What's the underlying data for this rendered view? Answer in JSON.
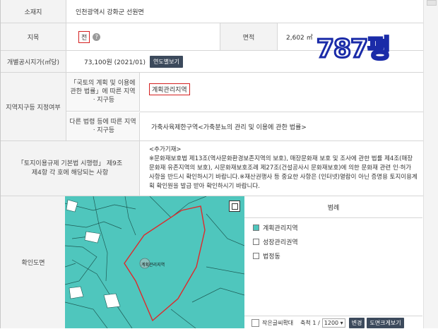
{
  "rows": {
    "location": {
      "label": "소재지",
      "value": "인천광역시 강화군 선원면"
    },
    "jimok": {
      "label": "지목",
      "value": "전",
      "area_label": "면적",
      "area_value": "2,602 ㎡"
    },
    "price": {
      "label": "개별공시지가(㎡당)",
      "value": "73,100원 (2021/01)",
      "button": "연도별보기"
    },
    "zone": {
      "label": "지역지구등 지정여부",
      "sub1_label": "「국토의 계획 및 이용에 관한 법률」에 따른 지역ㆍ지구등",
      "sub1_value": "계획관리지역",
      "sub2_label": "다른 법령 등에 따른 지역ㆍ지구등",
      "sub2_value": "가축사육제한구역<가축분뇨의 관리 및 이용에 관한 법률>"
    },
    "regulation": {
      "label": "「토지이용규제 기본법 시행령」 제9조 제4항 각 호에 해당되는 사항",
      "note_title": "<추가기재>",
      "note_body": "※문화재보호법 제13조(역사문화환경보존지역의 보호), 매장문화재 보호 및 조사에 관한 법률 제4조(매장문화재 유존지역의 보호), 시문화재보호조례 제27조(건설공사시 문화재보호)에 의한 문화재 관련 인·허가 사항을 반드시 확인하시기 바랍니다.※재산권행사 등 중요한 사항은 (인터넷)열람이 아닌 증명용 토지이용계획 확인원을 발급 받아 확인하시기 바랍니다."
    },
    "map_row": {
      "label": "확인도면"
    }
  },
  "overlay": {
    "pyeong": "787평"
  },
  "map": {
    "parcel_label": "계획관리지역"
  },
  "legend": {
    "title": "범례",
    "items": [
      {
        "label": "계획관리지역",
        "color": "#4fc6bd"
      },
      {
        "label": "성장관리권역",
        "color": "#ffffff"
      },
      {
        "label": "법정동",
        "color": "#ffffff"
      }
    ]
  },
  "bottom": {
    "small_text": "작은글씨확대",
    "scale_label": "축척 1 /",
    "scale_value": "1200",
    "change_button": "변경",
    "print_button": "도면크게보기"
  }
}
